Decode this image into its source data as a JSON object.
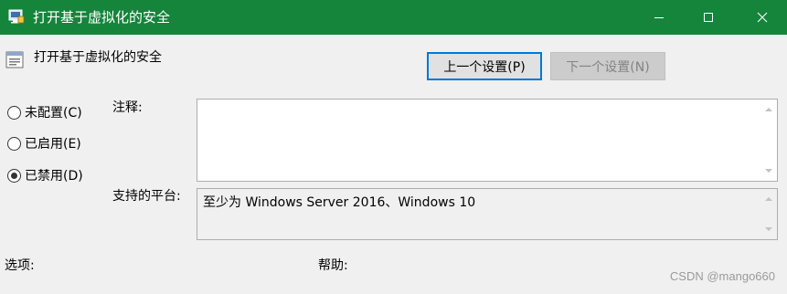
{
  "window": {
    "title": "打开基于虚拟化的安全"
  },
  "header": {
    "policy_title": "打开基于虚拟化的安全"
  },
  "navigation": {
    "prev_label": "上一个设置(P)",
    "next_label": "下一个设置(N)",
    "next_enabled": false
  },
  "state_options": [
    {
      "label": "未配置(C)",
      "selected": false
    },
    {
      "label": "已启用(E)",
      "selected": false
    },
    {
      "label": "已禁用(D)",
      "selected": true
    }
  ],
  "comment": {
    "label": "注释:",
    "value": ""
  },
  "supported_on": {
    "label": "支持的平台:",
    "value": "至少为 Windows Server 2016、Windows 10"
  },
  "sections": {
    "options_label": "选项:",
    "help_label": "帮助:"
  },
  "watermark": "CSDN @mango660",
  "colors": {
    "titlebar": "#14853b",
    "focus_border": "#0078d7",
    "window_bg": "#f0f0f0"
  },
  "icons": {
    "title": "policy-window-icon",
    "header": "policy-setting-icon",
    "minimize": "minimize-icon",
    "maximize": "maximize-icon",
    "close": "close-icon"
  }
}
